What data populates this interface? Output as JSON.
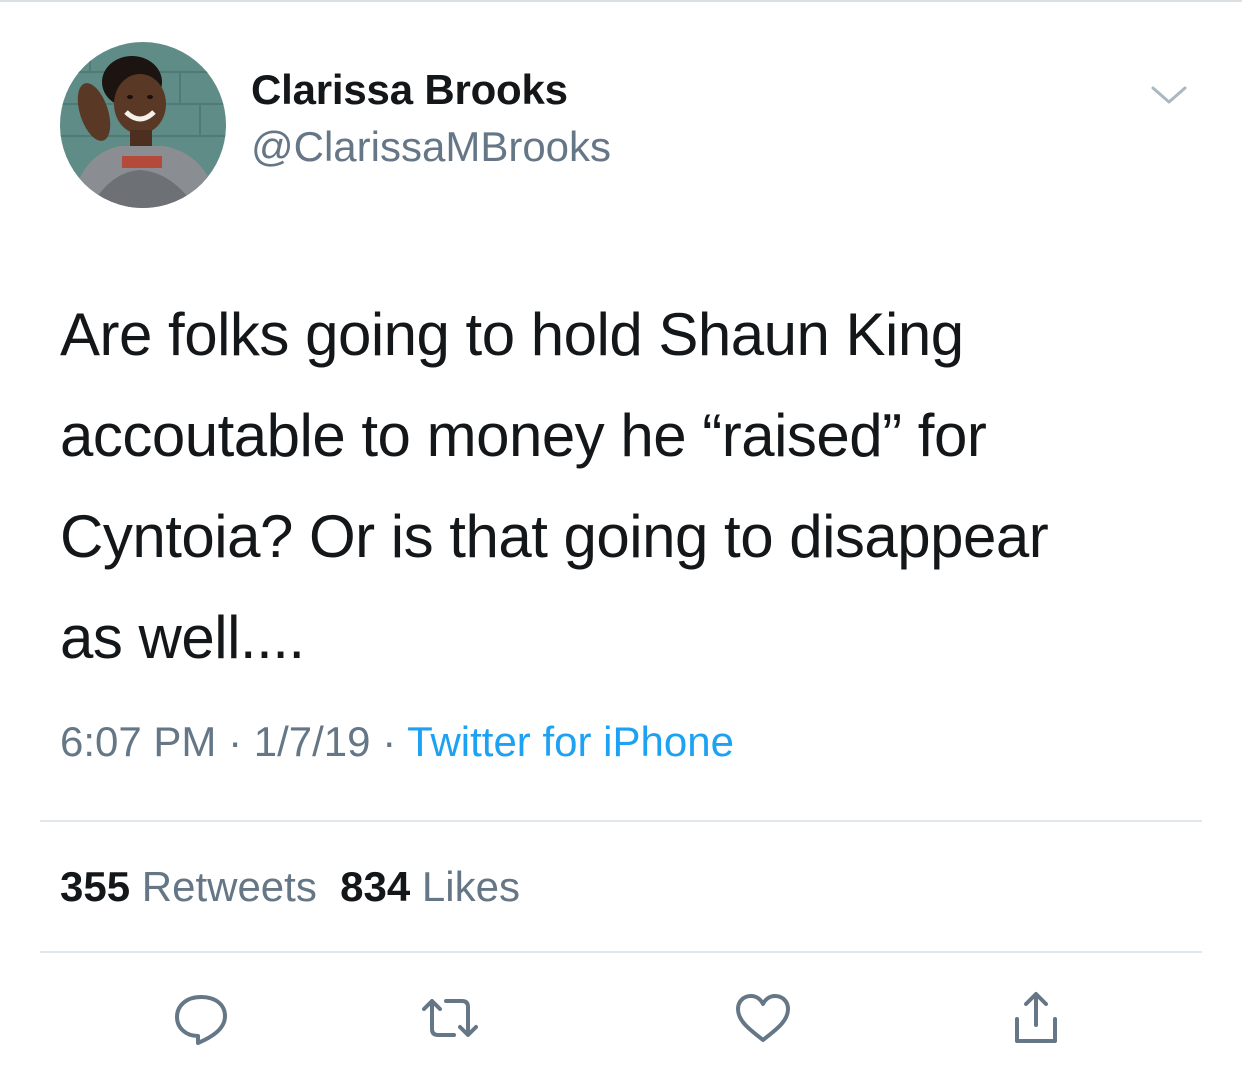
{
  "tweet": {
    "author": {
      "display_name": "Clarissa Brooks",
      "handle": "@ClarissaMBrooks"
    },
    "text_lines": [
      "Are folks going to hold Shaun King",
      "accoutable to money he “raised” for",
      "Cyntoia? Or is that going to disappear",
      "as well...."
    ],
    "time": "6:07 PM",
    "separator": " · ",
    "date": "1/7/19",
    "source": "Twitter for iPhone",
    "stats": {
      "retweets_count": "355",
      "retweets_label": "Retweets",
      "likes_count": "834",
      "likes_label": "Likes"
    }
  },
  "icons": {
    "more": "chevron-down-icon",
    "reply": "reply-icon",
    "retweet": "retweet-icon",
    "like": "heart-icon",
    "share": "share-icon"
  },
  "colors": {
    "text_primary": "#14171a",
    "text_secondary": "#657786",
    "link_blue": "#1da1f2",
    "divider": "#e1e8ed"
  }
}
